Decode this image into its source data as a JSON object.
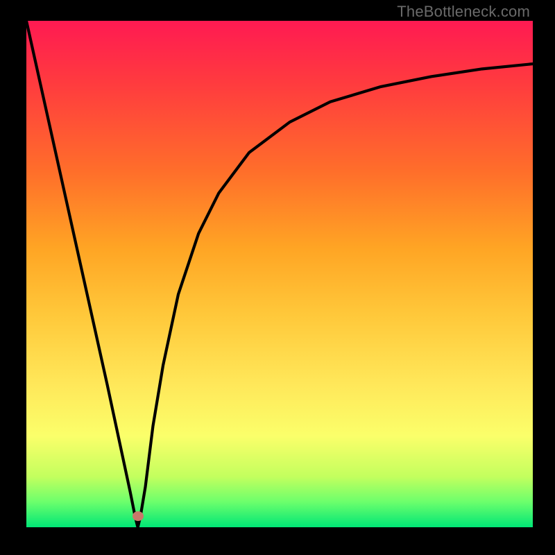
{
  "watermark": "TheBottleneck.com",
  "marker": {
    "x_pct": 22.0,
    "y_pct": 97.8,
    "color": "#c9786a"
  },
  "chart_data": {
    "type": "line",
    "title": "",
    "xlabel": "",
    "ylabel": "",
    "xlim": [
      0,
      100
    ],
    "ylim": [
      0,
      100
    ],
    "grid": false,
    "background": "heatmap-gradient (red top → green bottom)",
    "series": [
      {
        "name": "bottleneck-curve",
        "x": [
          0,
          4,
          8,
          12,
          16,
          19,
          20.5,
          21.5,
          22,
          22.5,
          23.5,
          25,
          27,
          30,
          34,
          38,
          44,
          52,
          60,
          70,
          80,
          90,
          100
        ],
        "y": [
          100,
          82,
          64,
          46,
          28,
          14,
          7,
          2,
          0,
          2,
          8,
          20,
          32,
          46,
          58,
          66,
          74,
          80,
          84,
          87,
          89,
          90.5,
          91.5
        ]
      }
    ],
    "annotations": [
      {
        "type": "marker",
        "x": 22,
        "y": 0,
        "shape": "ellipse",
        "color": "#c9786a"
      }
    ]
  }
}
